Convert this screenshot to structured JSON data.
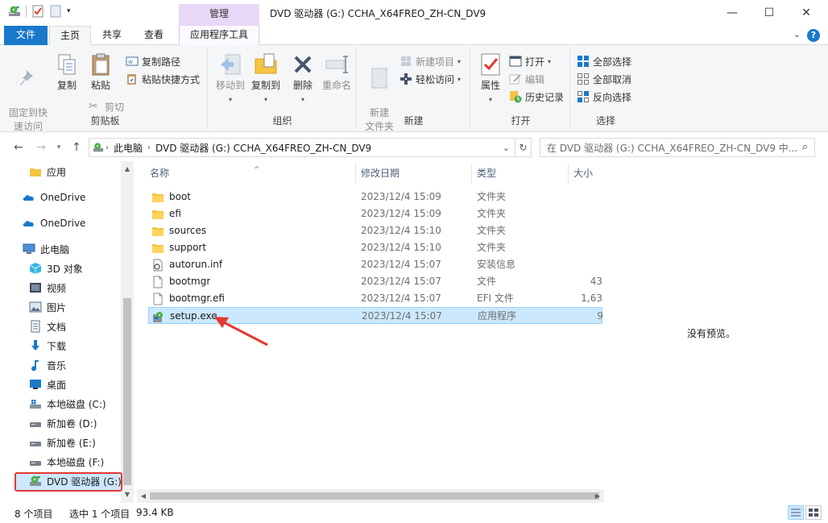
{
  "titlebar": {
    "context_tab": "管理",
    "title": "DVD 驱动器 (G:) CCHA_X64FREO_ZH-CN_DV9",
    "minimize_glyph": "—",
    "maximize_glyph": "☐",
    "close_glyph": "✕"
  },
  "tabs": {
    "file": "文件",
    "home": "主页",
    "share": "共享",
    "view": "查看",
    "app_tools": "应用程序工具",
    "help_glyph": "?"
  },
  "ribbon": {
    "clipboard": {
      "label": "剪贴板",
      "pin": "固定到快\n速访问",
      "copy": "复制",
      "paste": "粘贴",
      "copy_path": "复制路径",
      "paste_shortcut": "粘贴快捷方式",
      "cut": "剪切"
    },
    "organize": {
      "label": "组织",
      "move_to": "移动到",
      "copy_to": "复制到",
      "delete": "删除",
      "rename": "重命名"
    },
    "new": {
      "label": "新建",
      "new_folder": "新建\n文件夹",
      "new_item": "新建项目",
      "easy_access": "轻松访问"
    },
    "open": {
      "label": "打开",
      "properties": "属性",
      "open": "打开",
      "edit": "编辑",
      "history": "历史记录"
    },
    "select": {
      "label": "选择",
      "select_all": "全部选择",
      "select_none": "全部取消",
      "invert": "反向选择"
    }
  },
  "address": {
    "crumbs": [
      "此电脑",
      "DVD 驱动器 (G:) CCHA_X64FREO_ZH-CN_DV9"
    ],
    "search_placeholder": "在 DVD 驱动器 (G:) CCHA_X64FREO_ZH-CN_DV9 中..."
  },
  "nav": {
    "items": [
      {
        "label": "应用",
        "icon": "folder-icon"
      },
      {
        "label": "OneDrive",
        "icon": "cloud-icon"
      },
      {
        "label": "OneDrive",
        "icon": "cloud-icon"
      },
      {
        "label": "此电脑",
        "icon": "computer-icon"
      },
      {
        "label": "3D 对象",
        "icon": "cube-icon"
      },
      {
        "label": "视频",
        "icon": "video-icon"
      },
      {
        "label": "图片",
        "icon": "picture-icon"
      },
      {
        "label": "文档",
        "icon": "document-icon"
      },
      {
        "label": "下载",
        "icon": "download-icon"
      },
      {
        "label": "音乐",
        "icon": "music-icon"
      },
      {
        "label": "桌面",
        "icon": "desktop-icon"
      },
      {
        "label": "本地磁盘 (C:)",
        "icon": "system-drive-icon"
      },
      {
        "label": "新加卷 (D:)",
        "icon": "drive-icon"
      },
      {
        "label": "新加卷 (E:)",
        "icon": "drive-icon"
      },
      {
        "label": "本地磁盘 (F:)",
        "icon": "drive-icon"
      },
      {
        "label": "DVD 驱动器 (G:)",
        "icon": "dvd-drive-icon"
      }
    ]
  },
  "files": {
    "columns": {
      "name": "名称",
      "date": "修改日期",
      "type": "类型",
      "size": "大小"
    },
    "rows": [
      {
        "name": "boot",
        "date": "2023/12/4 15:09",
        "type": "文件夹",
        "size": "",
        "icon": "folder-icon"
      },
      {
        "name": "efi",
        "date": "2023/12/4 15:09",
        "type": "文件夹",
        "size": "",
        "icon": "folder-icon"
      },
      {
        "name": "sources",
        "date": "2023/12/4 15:10",
        "type": "文件夹",
        "size": "",
        "icon": "folder-icon"
      },
      {
        "name": "support",
        "date": "2023/12/4 15:10",
        "type": "文件夹",
        "size": "",
        "icon": "folder-icon"
      },
      {
        "name": "autorun.inf",
        "date": "2023/12/4 15:07",
        "type": "安装信息",
        "size": "",
        "icon": "settings-file-icon"
      },
      {
        "name": "bootmgr",
        "date": "2023/12/4 15:07",
        "type": "文件",
        "size": "43",
        "icon": "file-icon"
      },
      {
        "name": "bootmgr.efi",
        "date": "2023/12/4 15:07",
        "type": "EFI 文件",
        "size": "1,63",
        "icon": "file-icon"
      },
      {
        "name": "setup.exe",
        "date": "2023/12/4 15:07",
        "type": "应用程序",
        "size": "9",
        "icon": "setup-exe-icon"
      }
    ]
  },
  "preview": {
    "text": "没有预览。"
  },
  "status": {
    "count": "8 个项目",
    "selected": "选中 1 个项目",
    "size": "93.4 KB"
  },
  "colors": {
    "accent": "#1979ca",
    "selection": "#cce8ff",
    "context_tab": "#e9d8f7",
    "annotation": "#e53935"
  }
}
